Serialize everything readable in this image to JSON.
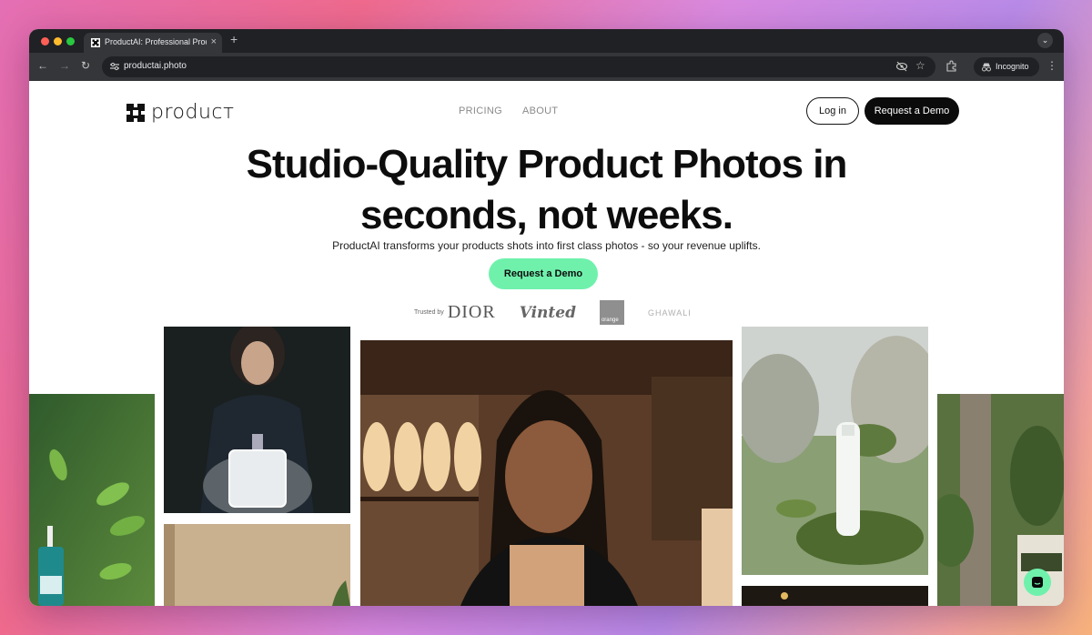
{
  "browser": {
    "tab_title": "ProductAI: Professional Product",
    "tab_close": "×",
    "new_tab": "+",
    "tab_menu": "⌄",
    "url": "productai.photo",
    "incognito_label": "Incognito",
    "kebab": "⋮"
  },
  "nav": {
    "logo_text": "producт",
    "links": [
      "PRICING",
      "ABOUT"
    ],
    "login_label": "Log in",
    "demo_label": "Request a Demo"
  },
  "hero": {
    "title_line1": "Studio-Quality Product Photos in",
    "title_line2": "seconds, not weeks.",
    "subtitle": "ProductAI transforms your products shots into first class photos - so your revenue uplifts.",
    "cta_label": "Request a Demo"
  },
  "trusted": {
    "label": "Trusted by",
    "brands": [
      "DIOR",
      "Vinted",
      "orange",
      "GHAWALI"
    ]
  },
  "colors": {
    "accent_green": "#6ff1ac",
    "button_dark": "#0b0b0b",
    "browser_dark": "#202124"
  },
  "icons": {
    "back": "←",
    "forward": "→",
    "reload": "↻",
    "star": "☆"
  }
}
